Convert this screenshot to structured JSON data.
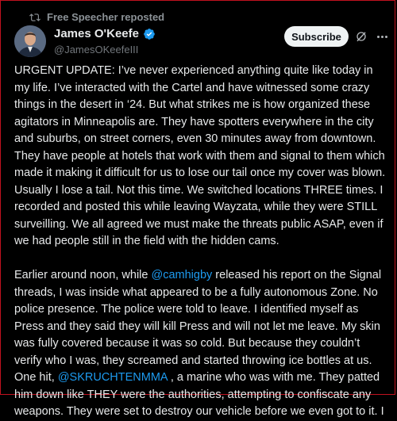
{
  "repost_label": "Free Speecher reposted",
  "author": {
    "name": "James O'Keefe",
    "handle": "@JamesOKeefeIII",
    "verified": true
  },
  "subscribe_label": "Subscribe",
  "icons": [
    "repost-icon",
    "verified-badge-icon",
    "grok-icon",
    "more-options-icon"
  ],
  "colors": {
    "background": "#000000",
    "text": "#e7e9ea",
    "secondary_text": "#71767b",
    "mention": "#1d9bf0",
    "verified": "#1d9bf0",
    "button_bg": "#eff3f4",
    "frame_border": "#c1121f"
  },
  "post": {
    "paragraph1": "URGENT UPDATE: I’ve never experienced anything quite like today in my life. I’ve interacted with the Cartel and have witnessed some crazy things in the desert in ‘24. But what strikes me is how organized these agitators in Minneapolis are. They have spotters everywhere in the city and suburbs, on street corners, even 30 minutes away from downtown. They have people at hotels that work with them and signal to them which made it making it difficult for us to lose our tail once my cover was blown. Usually I lose a tail. Not this time. We switched locations THREE times. I recorded and posted this while leaving Wayzata, while they were STILL surveilling. We all agreed we must make the threats public ASAP, even if we had people still in the field with the hidden cams.",
    "p2_a": "Earlier around noon, while ",
    "mention1": "@camhigby",
    "p2_b": " released his report on the Signal threads, I was inside what appeared to be a fully autonomous Zone. No police presence. The police were told to leave. I  identified myself as Press and they said they will kill Press and will not let me leave. My skin was fully covered because it was so cold. But because they couldn’t verify who I was, they screamed and started throwing ice bottles at us. One hit, ",
    "mention2": "@SKRUCHTENMMA",
    "p2_c": " , a marine who was with me. They patted him down like THEY were the authorities, attempting to confiscate any weapons. They were set to destroy our vehicle before we even got to it. I"
  }
}
